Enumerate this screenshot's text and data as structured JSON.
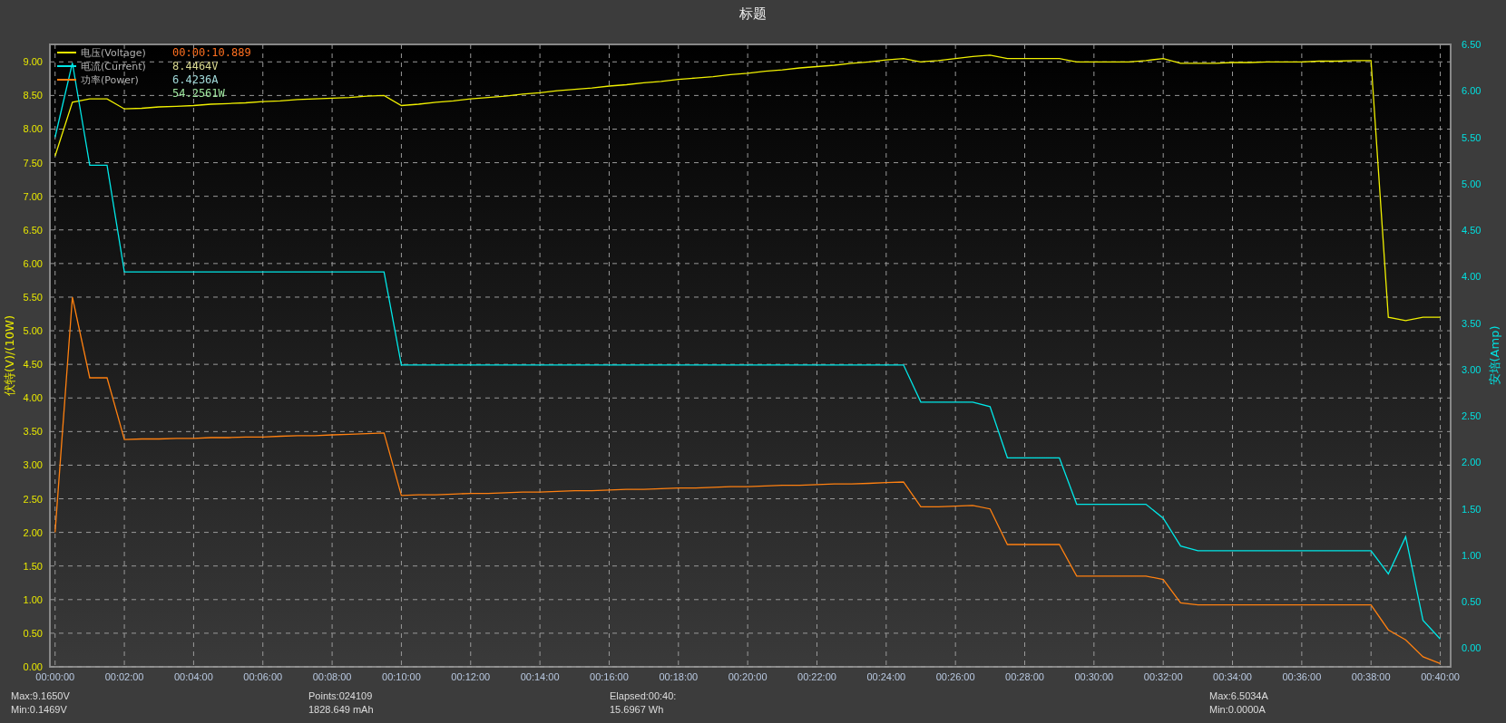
{
  "window": {
    "title": "标题"
  },
  "chart": {
    "chart_data": {
      "type": "line",
      "grid": true,
      "legend": "upper left",
      "ylabel": "伏特(V)/(10W)",
      "y2label": "安培(Amp)",
      "x": [
        0,
        0.5,
        1,
        1.5,
        2,
        2.5,
        3,
        3.5,
        4,
        4.5,
        5,
        5.5,
        6,
        6.5,
        7,
        7.5,
        8,
        8.5,
        9,
        9.5,
        10,
        10.5,
        11,
        11.5,
        12,
        12.5,
        13,
        13.5,
        14,
        14.5,
        15,
        15.5,
        16,
        16.5,
        17,
        17.5,
        18,
        18.5,
        19,
        19.5,
        20,
        20.5,
        21,
        21.5,
        22,
        22.5,
        23,
        23.5,
        24,
        24.5,
        25,
        25.5,
        26,
        26.5,
        27,
        27.5,
        28,
        28.5,
        29,
        29.5,
        30,
        30.5,
        31,
        31.5,
        32,
        32.5,
        33,
        33.5,
        34,
        34.5,
        35,
        35.5,
        36,
        36.5,
        37,
        37.5,
        38,
        38.5,
        39,
        39.5,
        40
      ],
      "xlim": [
        -0.15,
        40.3
      ],
      "ylim": [
        0,
        9.26
      ],
      "y2lim": [
        -0.2,
        6.5
      ],
      "xticks": [
        {
          "value": 0,
          "label": "00:00:00"
        },
        {
          "value": 2,
          "label": "00:02:00"
        },
        {
          "value": 4,
          "label": "00:04:00"
        },
        {
          "value": 6,
          "label": "00:06:00"
        },
        {
          "value": 8,
          "label": "00:08:00"
        },
        {
          "value": 10,
          "label": "00:10:00"
        },
        {
          "value": 12,
          "label": "00:12:00"
        },
        {
          "value": 14,
          "label": "00:14:00"
        },
        {
          "value": 16,
          "label": "00:16:00"
        },
        {
          "value": 18,
          "label": "00:18:00"
        },
        {
          "value": 20,
          "label": "00:20:00"
        },
        {
          "value": 22,
          "label": "00:22:00"
        },
        {
          "value": 24,
          "label": "00:24:00"
        },
        {
          "value": 26,
          "label": "00:26:00"
        },
        {
          "value": 28,
          "label": "00:28:00"
        },
        {
          "value": 30,
          "label": "00:30:00"
        },
        {
          "value": 32,
          "label": "00:32:00"
        },
        {
          "value": 34,
          "label": "00:34:00"
        },
        {
          "value": 36,
          "label": "00:36:00"
        },
        {
          "value": 38,
          "label": "00:38:00"
        },
        {
          "value": 40,
          "label": "00:40:00"
        }
      ],
      "yticks": [
        {
          "value": 0,
          "label": "0.00"
        },
        {
          "value": 0.5,
          "label": "0.50"
        },
        {
          "value": 1,
          "label": "1.00"
        },
        {
          "value": 1.5,
          "label": "1.50"
        },
        {
          "value": 2,
          "label": "2.00"
        },
        {
          "value": 2.5,
          "label": "2.50"
        },
        {
          "value": 3,
          "label": "3.00"
        },
        {
          "value": 3.5,
          "label": "3.50"
        },
        {
          "value": 4,
          "label": "4.00"
        },
        {
          "value": 4.5,
          "label": "4.50"
        },
        {
          "value": 5,
          "label": "5.00"
        },
        {
          "value": 5.5,
          "label": "5.50"
        },
        {
          "value": 6,
          "label": "6.00"
        },
        {
          "value": 6.5,
          "label": "6.50"
        },
        {
          "value": 7,
          "label": "7.00"
        },
        {
          "value": 7.5,
          "label": "7.50"
        },
        {
          "value": 8,
          "label": "8.00"
        },
        {
          "value": 8.5,
          "label": "8.50"
        },
        {
          "value": 9,
          "label": "9.00"
        }
      ],
      "y2ticks": [
        {
          "value": 0,
          "label": "0.00"
        },
        {
          "value": 0.5,
          "label": "0.50"
        },
        {
          "value": 1,
          "label": "1.00"
        },
        {
          "value": 1.5,
          "label": "1.50"
        },
        {
          "value": 2,
          "label": "2.00"
        },
        {
          "value": 2.5,
          "label": "2.50"
        },
        {
          "value": 3,
          "label": "3.00"
        },
        {
          "value": 3.5,
          "label": "3.50"
        },
        {
          "value": 4,
          "label": "4.00"
        },
        {
          "value": 4.5,
          "label": "4.50"
        },
        {
          "value": 5,
          "label": "5.00"
        },
        {
          "value": 5.5,
          "label": "5.50"
        },
        {
          "value": 6,
          "label": "6.00"
        },
        {
          "value": 6.5,
          "label": "6.50"
        }
      ],
      "series": [
        {
          "name": "电压(Voltage)",
          "color": "#f0f000",
          "values": [
            7.6,
            8.4,
            8.45,
            8.45,
            8.3,
            8.31,
            8.33,
            8.34,
            8.35,
            8.37,
            8.38,
            8.39,
            8.41,
            8.42,
            8.44,
            8.45,
            8.46,
            8.47,
            8.49,
            8.5,
            8.35,
            8.37,
            8.4,
            8.42,
            8.45,
            8.47,
            8.49,
            8.52,
            8.54,
            8.57,
            8.59,
            8.61,
            8.64,
            8.66,
            8.69,
            8.71,
            8.74,
            8.76,
            8.78,
            8.81,
            8.83,
            8.86,
            8.88,
            8.91,
            8.93,
            8.95,
            8.98,
            9.0,
            9.03,
            9.05,
            9.0,
            9.02,
            9.05,
            9.08,
            9.1,
            9.05,
            9.05,
            9.05,
            9.05,
            9.0,
            9.0,
            9.0,
            9.0,
            9.02,
            9.05,
            8.98,
            8.98,
            8.98,
            8.99,
            8.99,
            9.0,
            9.0,
            9.0,
            9.01,
            9.01,
            9.02,
            9.02,
            5.2,
            5.15,
            5.2,
            5.2
          ]
        },
        {
          "name": "电流(Current)",
          "color": "#00e8e8",
          "axis": "y2",
          "values": [
            5.5,
            6.3,
            5.2,
            5.2,
            4.05,
            4.05,
            4.05,
            4.05,
            4.05,
            4.05,
            4.05,
            4.05,
            4.05,
            4.05,
            4.05,
            4.05,
            4.05,
            4.05,
            4.05,
            4.05,
            3.05,
            3.05,
            3.05,
            3.05,
            3.05,
            3.05,
            3.05,
            3.05,
            3.05,
            3.05,
            3.05,
            3.05,
            3.05,
            3.05,
            3.05,
            3.05,
            3.05,
            3.05,
            3.05,
            3.05,
            3.05,
            3.05,
            3.05,
            3.05,
            3.05,
            3.05,
            3.05,
            3.05,
            3.05,
            3.05,
            2.65,
            2.65,
            2.65,
            2.65,
            2.6,
            2.05,
            2.05,
            2.05,
            2.05,
            1.55,
            1.55,
            1.55,
            1.55,
            1.55,
            1.4,
            1.1,
            1.05,
            1.05,
            1.05,
            1.05,
            1.05,
            1.05,
            1.05,
            1.05,
            1.05,
            1.05,
            1.05,
            0.8,
            1.2,
            0.3,
            0.1
          ]
        },
        {
          "name": "功率(Power)",
          "color": "#ff8010",
          "values": [
            2.0,
            5.5,
            4.3,
            4.3,
            3.38,
            3.39,
            3.39,
            3.4,
            3.4,
            3.41,
            3.41,
            3.42,
            3.42,
            3.43,
            3.44,
            3.44,
            3.45,
            3.46,
            3.47,
            3.48,
            2.55,
            2.56,
            2.56,
            2.57,
            2.58,
            2.58,
            2.59,
            2.6,
            2.6,
            2.61,
            2.62,
            2.62,
            2.63,
            2.64,
            2.64,
            2.65,
            2.66,
            2.66,
            2.67,
            2.68,
            2.68,
            2.69,
            2.7,
            2.7,
            2.71,
            2.72,
            2.72,
            2.73,
            2.74,
            2.75,
            2.38,
            2.38,
            2.39,
            2.4,
            2.35,
            1.82,
            1.82,
            1.82,
            1.82,
            1.35,
            1.35,
            1.35,
            1.35,
            1.35,
            1.3,
            0.95,
            0.92,
            0.92,
            0.92,
            0.92,
            0.92,
            0.92,
            0.92,
            0.92,
            0.92,
            0.92,
            0.92,
            0.55,
            0.4,
            0.15,
            0.05
          ]
        }
      ]
    },
    "cursor_readout": {
      "time": {
        "text": "00:00:10.889",
        "color": "#ff7020"
      },
      "values": [
        {
          "text": "8.4464V",
          "color": "#d8d890"
        },
        {
          "text": "6.4236A",
          "color": "#a0d8d8"
        },
        {
          "text": "54.2561W",
          "color": "#a0e8a0"
        }
      ]
    }
  },
  "stats": [
    [
      "Max:9.1650V",
      "Min:0.1469V"
    ],
    [
      "Points:024109",
      "1828.649 mAh"
    ],
    [
      "Elapsed:00:40:",
      "15.6967 Wh"
    ],
    [
      "Max:6.5034A",
      "Min:0.0000A"
    ]
  ]
}
